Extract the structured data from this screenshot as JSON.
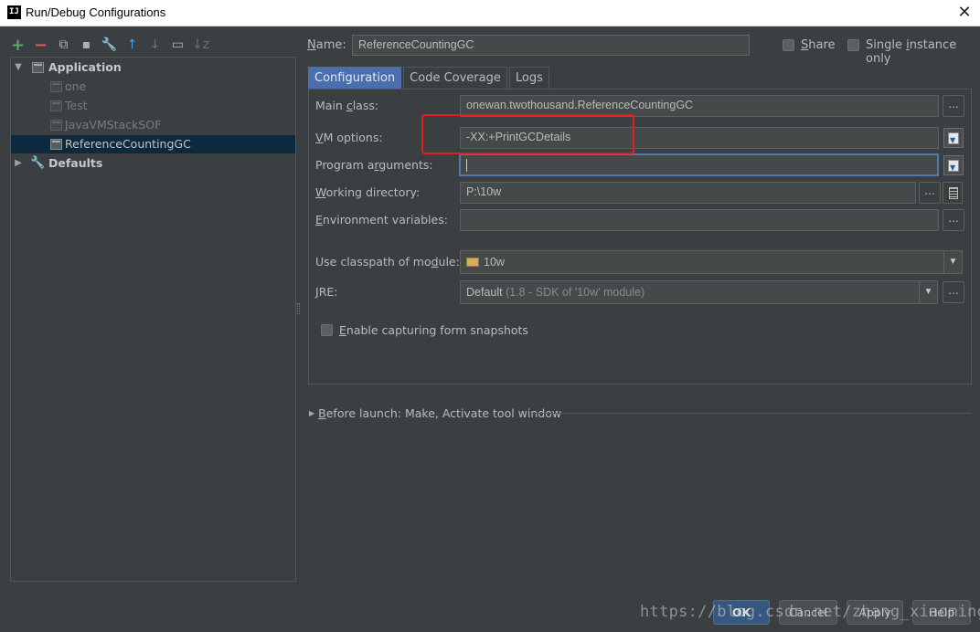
{
  "window": {
    "title": "Run/Debug Configurations",
    "app_icon": "IJ",
    "close_glyph": "✕"
  },
  "toolbar": {
    "add": "+",
    "remove": "−",
    "copy": "⧉",
    "save": "▪",
    "edit_defaults": "🔧",
    "move_up": "↑",
    "move_down": "↓",
    "folder": "▭",
    "sort": "↓z"
  },
  "tree": {
    "application_label": "Application",
    "items": [
      "one",
      "Test",
      "JavaVMStackSOF",
      "ReferenceCountingGC"
    ],
    "defaults_label": "Defaults"
  },
  "name": {
    "label_prefix": "N",
    "label_rest": "ame:",
    "value": "ReferenceCountingGC"
  },
  "share": {
    "label_prefix": "S",
    "label_rest": "hare"
  },
  "single_instance": {
    "label_pre": "Single ",
    "label_u": "i",
    "label_rest": "nstance only"
  },
  "tabs": [
    "Configuration",
    "Code Coverage",
    "Logs"
  ],
  "fields": {
    "main_class": {
      "label_pre": "Main ",
      "label_u": "c",
      "label_rest": "lass:",
      "value": "onewan.twothousand.ReferenceCountingGC"
    },
    "vm_options": {
      "label_u": "V",
      "label_rest": "M options:",
      "value": "-XX:+PrintGCDetails"
    },
    "program_args": {
      "label_pre": "Program a",
      "label_u": "r",
      "label_rest": "guments:",
      "value": ""
    },
    "working_dir": {
      "label_u": "W",
      "label_rest": "orking directory:",
      "value": "P:\\10w"
    },
    "env_vars": {
      "label_u": "E",
      "label_rest": "nvironment variables:",
      "value": ""
    },
    "classpath": {
      "label_pre": "Use classpath of mo",
      "label_u": "d",
      "label_rest": "ule:",
      "value": "10w"
    },
    "jre": {
      "label_u": "J",
      "label_rest": "RE:",
      "value": "Default",
      "hint": "(1.8 - SDK of '10w' module)"
    }
  },
  "ellipsis": "...",
  "snapshots": {
    "label_u": "E",
    "label_rest": "nable capturing form snapshots"
  },
  "before_launch": {
    "label_u": "B",
    "label_rest": "efore launch: Make, Activate tool window"
  },
  "buttons": {
    "ok": "OK",
    "cancel": "Cancel",
    "apply": "Apply",
    "help": "Help"
  },
  "watermark": "https://blog.csdn.net/zhang_xiaoming",
  "colors": {
    "background": "#3c3f41",
    "selection": "#0d293e",
    "active_tab": "#4b6eaf",
    "highlight_box": "#e02020",
    "ok_button": "#365880"
  }
}
